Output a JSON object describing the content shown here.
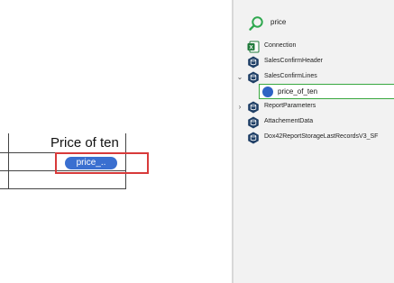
{
  "report": {
    "column_header": "Price of ten",
    "field_chip_label": "price_..",
    "accent_color": "#3a6fd0",
    "highlight_color": "#d83a3a"
  },
  "field_explorer": {
    "search": {
      "icon": "search-icon",
      "value": "price"
    },
    "items": [
      {
        "label": "Connection",
        "icon": "excel-icon",
        "expand_state": "none"
      },
      {
        "label": "SalesConfirmHeader",
        "icon": "datasource-icon",
        "expand_state": "none"
      },
      {
        "label": "SalesConfirmLines",
        "icon": "datasource-icon",
        "expand_state": "expanded"
      },
      {
        "label": "ReportParameters",
        "icon": "datasource-icon",
        "expand_state": "collapsed"
      },
      {
        "label": "AttachementData",
        "icon": "datasource-icon",
        "expand_state": "none"
      },
      {
        "label": "Dox42ReportStorageLastRecordsV3_SF",
        "icon": "datasource-icon",
        "expand_state": "none"
      }
    ],
    "selected_field": {
      "label": "price_of_ten",
      "icon": "field-icon",
      "highlight_color": "#38a83f"
    }
  }
}
